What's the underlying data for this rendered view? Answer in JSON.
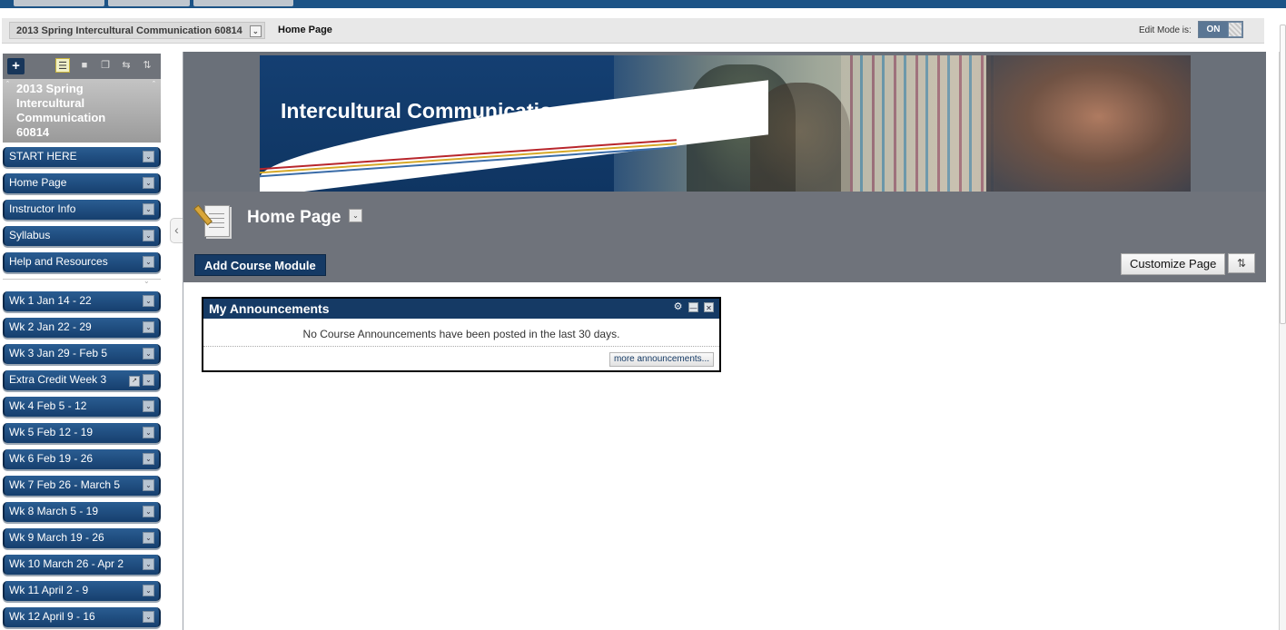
{
  "breadcrumb": {
    "course": "2013 Spring Intercultural Communication 60814",
    "page": "Home Page"
  },
  "edit_mode": {
    "label": "Edit Mode is:",
    "state": "ON"
  },
  "sidebar": {
    "course_title": "2013 Spring Intercultural Communication 60814",
    "add_icon": "plus-icon",
    "items": [
      {
        "label": "START HERE"
      },
      {
        "label": "Home Page"
      },
      {
        "label": "Instructor Info"
      },
      {
        "label": "Syllabus"
      },
      {
        "label": "Help and Resources"
      },
      {
        "label": "Wk 1 Jan 14 - 22"
      },
      {
        "label": "Wk 2 Jan 22 - 29"
      },
      {
        "label": "Wk 3 Jan 29 - Feb 5"
      },
      {
        "label": "Extra Credit Week 3"
      },
      {
        "label": "Wk 4 Feb 5 - 12"
      },
      {
        "label": "Wk 5 Feb 12 - 19"
      },
      {
        "label": "Wk 6 Feb 19 - 26"
      },
      {
        "label": "Wk 7 Feb 26 - March 5"
      },
      {
        "label": "Wk 8 March 5 - 19"
      },
      {
        "label": "Wk 9 March 19 - 26"
      },
      {
        "label": "Wk 10 March 26 - Apr 2"
      },
      {
        "label": "Wk 11 April 2 - 9"
      },
      {
        "label": "Wk 12 April 9 - 16"
      }
    ]
  },
  "banner": {
    "title": "Intercultural Communication"
  },
  "page": {
    "title": "Home Page",
    "add_module_label": "Add Course Module",
    "customize_label": "Customize Page"
  },
  "module": {
    "title": "My Announcements",
    "message": "No Course Announcements have been posted in the last 30 days.",
    "more_label": "more announcements..."
  },
  "colors": {
    "nav_blue": "#153a65",
    "header_gray": "#6f737b",
    "menu_blue": "#2a5d92"
  }
}
